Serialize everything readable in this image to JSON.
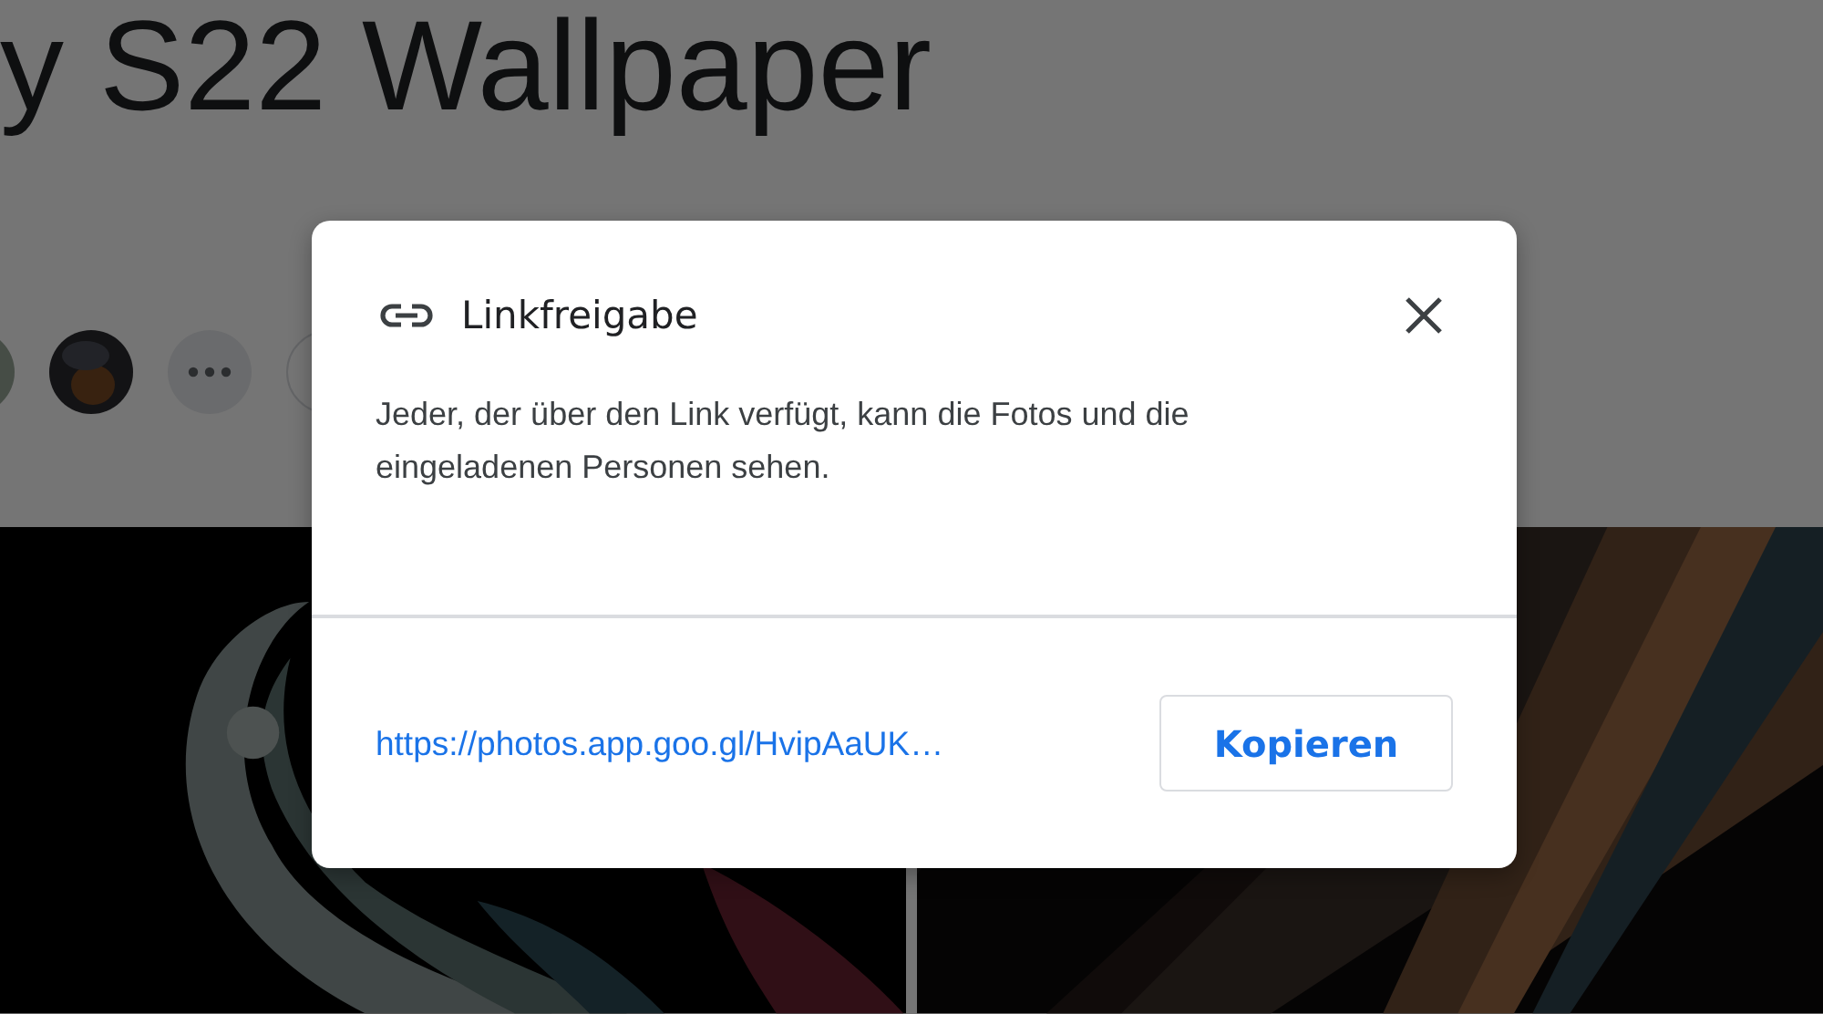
{
  "page": {
    "title": "y S22 Wallpaper"
  },
  "dialog": {
    "title": "Linkfreigabe",
    "message": "Jeder, der über den Link verfügt, kann die Fotos und die eingeladenen Personen sehen.",
    "link": "https://photos.app.goo.gl/HvipAaUK…",
    "copy_button": "Kopieren"
  }
}
